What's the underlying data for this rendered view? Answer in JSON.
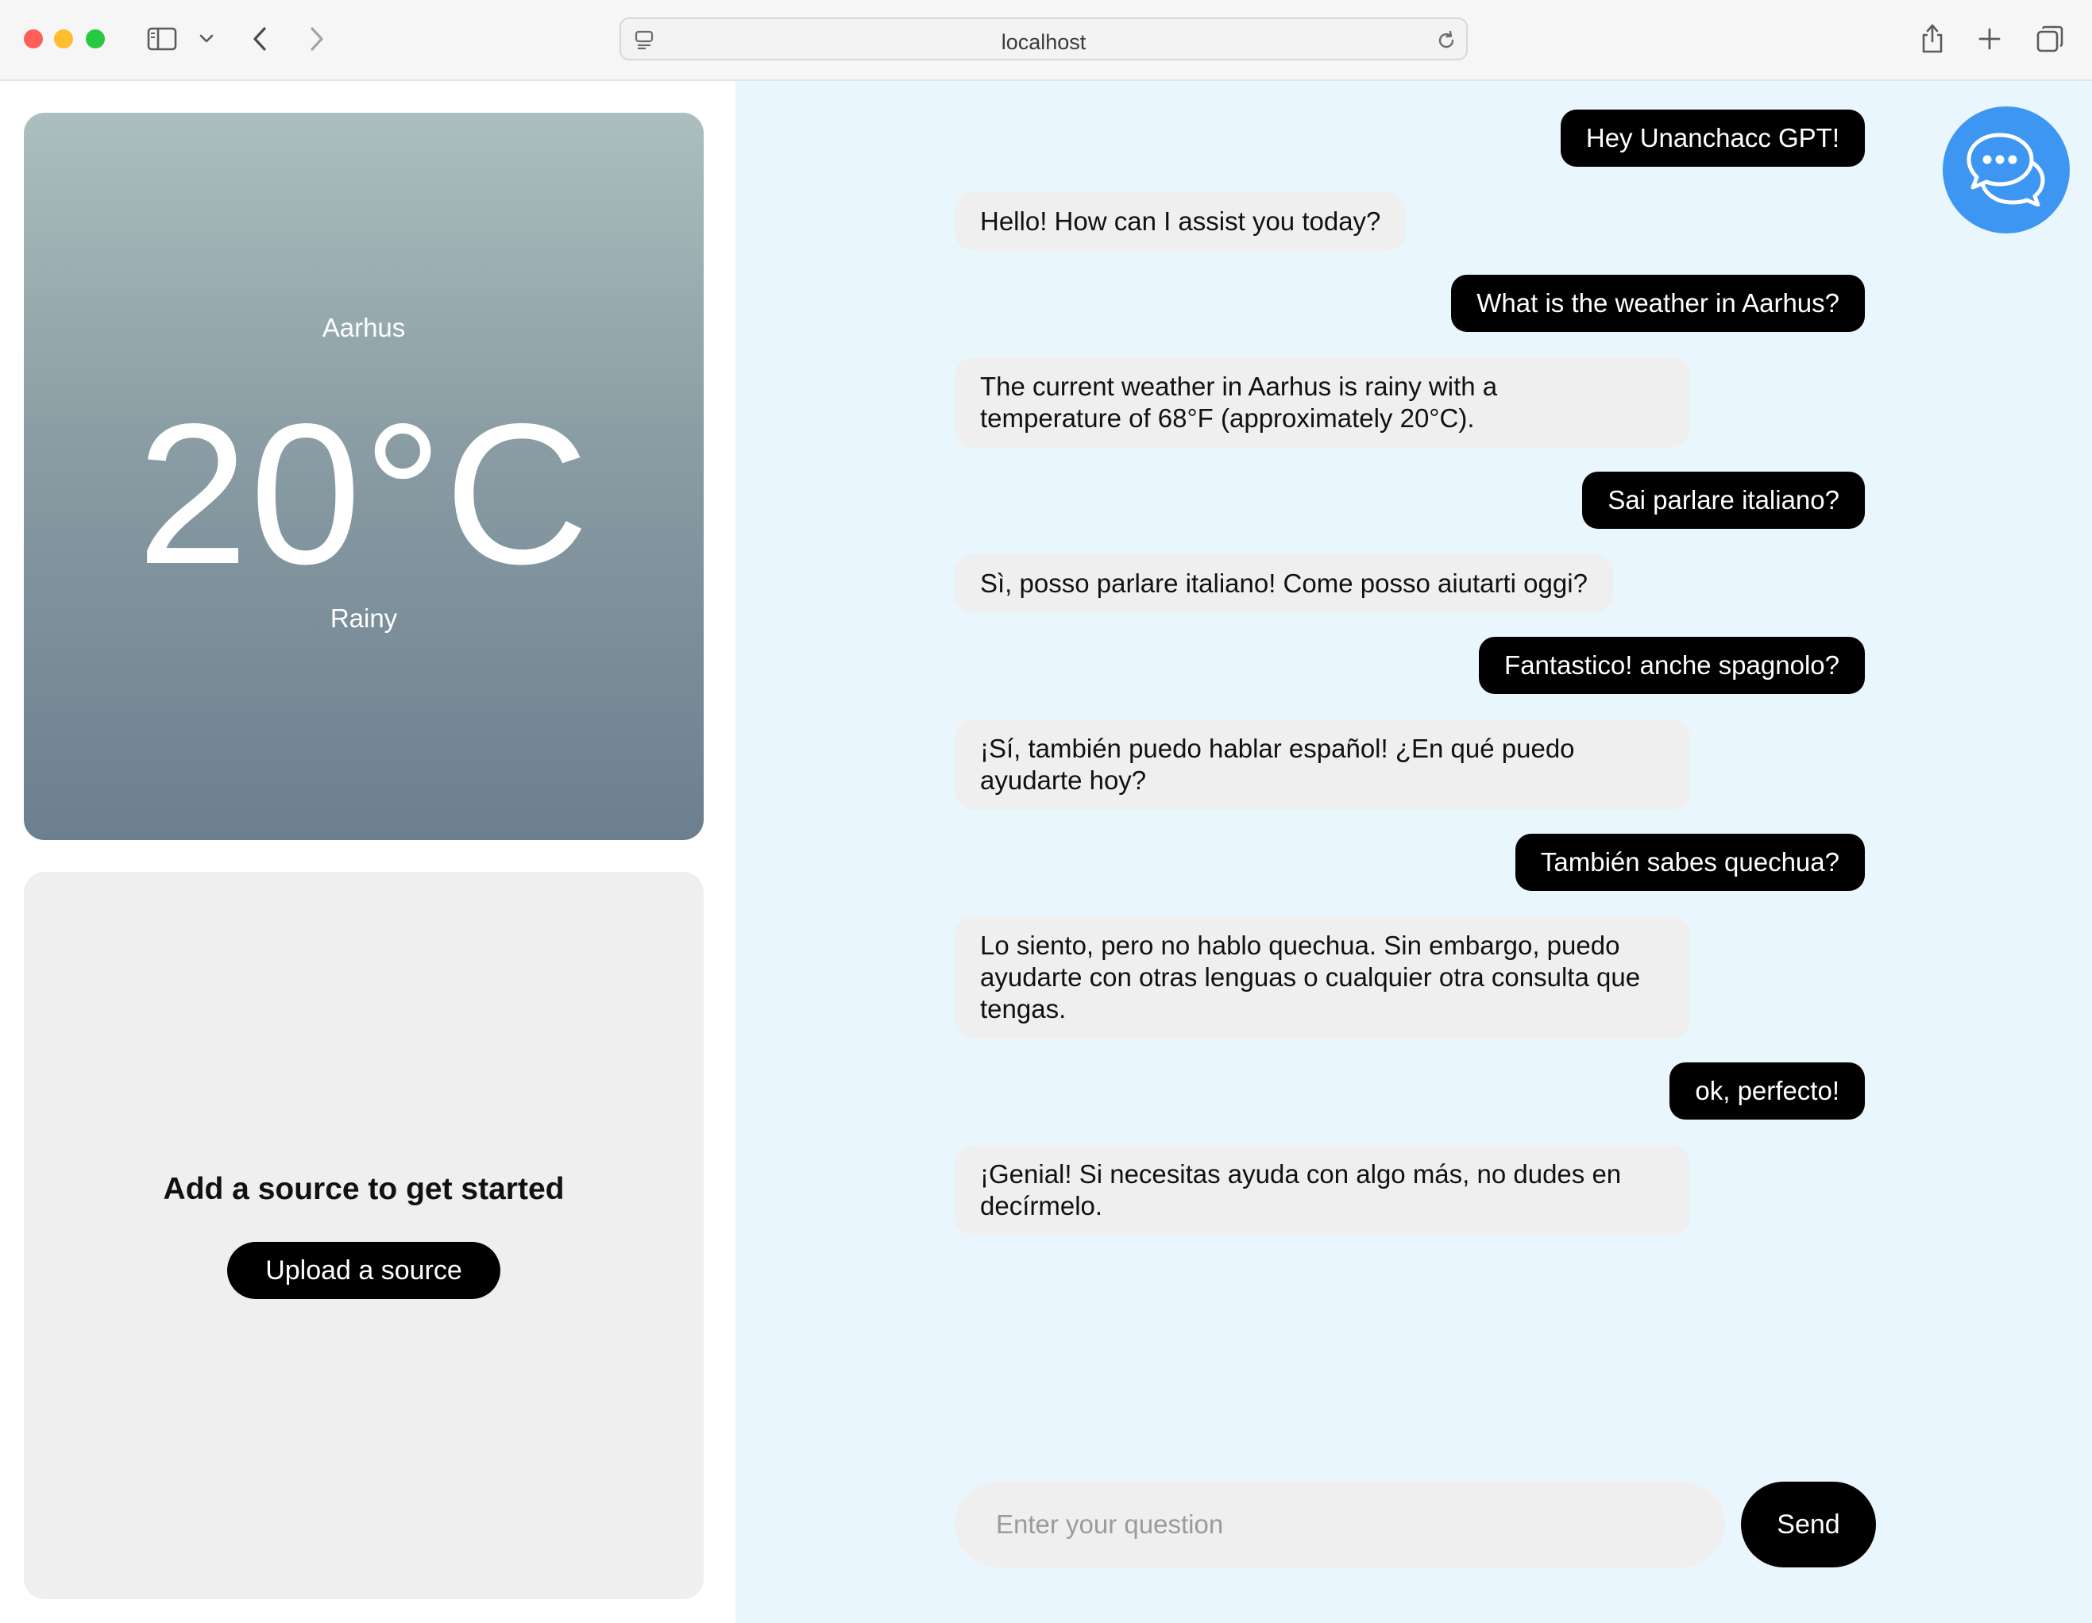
{
  "browser": {
    "url": "localhost"
  },
  "weather": {
    "city": "Aarhus",
    "temperature": "20°C",
    "condition": "Rainy"
  },
  "source": {
    "title": "Add a source to get started",
    "upload_label": "Upload a source"
  },
  "chat": {
    "messages": [
      {
        "role": "user",
        "text": "Hey Unanchacc GPT!"
      },
      {
        "role": "assistant",
        "text": "Hello! How can I assist you today?"
      },
      {
        "role": "user",
        "text": "What is the weather in Aarhus?"
      },
      {
        "role": "assistant",
        "text": "The current weather in Aarhus is rainy with a\ntemperature of 68°F (approximately 20°C)."
      },
      {
        "role": "user",
        "text": "Sai parlare italiano?"
      },
      {
        "role": "assistant",
        "text": "Sì, posso parlare italiano! Come posso aiutarti oggi?"
      },
      {
        "role": "user",
        "text": "Fantastico! anche spagnolo?"
      },
      {
        "role": "assistant",
        "text": "¡Sí, también puedo hablar español! ¿En qué puedo\nayudarte hoy?"
      },
      {
        "role": "user",
        "text": "También sabes quechua?"
      },
      {
        "role": "assistant",
        "text": "Lo siento, pero no hablo quechua. Sin embargo, puedo\nayudarte con otras lenguas o cualquier otra consulta que\ntengas."
      },
      {
        "role": "user",
        "text": "ok, perfecto!"
      },
      {
        "role": "assistant",
        "text": "¡Genial! Si necesitas ayuda con algo más, no dudes en\ndecírmelo."
      }
    ],
    "input_placeholder": "Enter your question",
    "input_value": "",
    "send_label": "Send"
  },
  "icons": {
    "sidebar": "sidebar-icon",
    "back": "chevron-left-icon",
    "forward": "chevron-right-icon",
    "reload": "reload-icon",
    "share": "share-icon",
    "new_tab": "plus-icon",
    "tabs": "tabs-icon",
    "chat": "chat-bubbles-icon"
  },
  "colors": {
    "chat_background": "#eaf6fd",
    "user_bubble": "#000000",
    "bot_bubble": "#efefef",
    "accent": "#3d97f2"
  }
}
